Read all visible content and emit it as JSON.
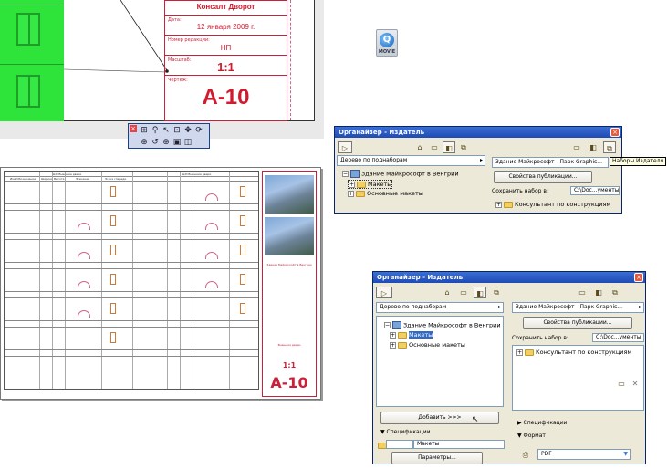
{
  "drawing_top": {
    "title_block": {
      "author_value": "Консалт Дворот",
      "date_label": "Дата:",
      "date_value": "12 января 2009 г.",
      "revision_label": "Номер редакции:",
      "revision_value": "НП",
      "scale_label": "Масштаб:",
      "scale_value": "1:1",
      "sheet_label": "Чертеж:",
      "sheet_value": "A-10"
    }
  },
  "drawing_bottom": {
    "header_left": "Ш/И Внешние двери",
    "header_right": "Ш/И Внешние двери",
    "col_headers": [
      "Имя/Обозначение",
      "Ширина",
      "Высота",
      "Эскизная",
      "Эскиз спереди"
    ],
    "title_project": "Здание Майкрософт в Венгрии",
    "title_sheet_name": "Внешние двери",
    "title_scale": "1:1",
    "title_sheet": "A-10"
  },
  "movie_icon": {
    "label": "MOVIE"
  },
  "organizer_small": {
    "title": "Органайзер - Издатель",
    "left_dropdown": "Дерево по поднаборам",
    "right_dropdown": "Здание Майкрософт - Парк Graphis...",
    "tooltip": "Наборы Издателя",
    "tree": [
      "Здание Майкрософт в Венгрии",
      "Макеты",
      "Основные макеты"
    ],
    "publish_props_button": "Свойства публикации...",
    "save_set_label": "Сохранить набор в:",
    "save_set_path": "C:\\Doc...ументы",
    "right_tree_item": "Консультант по конструкциям"
  },
  "organizer_large": {
    "title": "Органайзер - Издатель",
    "left_dropdown": "Дерево по поднаборам",
    "right_dropdown": "Здание Майкрософт - Парк Graphis...",
    "tree": [
      "Здание Майкрософт в Венгрии",
      "Макеты",
      "Основные макеты"
    ],
    "publish_props_button": "Свойства публикации...",
    "save_set_label": "Сохранить набор в:",
    "save_set_path": "C:\\Doc...ументы",
    "right_tree_item": "Консультант по конструкциям",
    "add_button": "Добавить >>>",
    "specs_left": "Спецификации",
    "layouts_field": "Макеты",
    "params_button": "Параметры...",
    "specs_right": "Спецификации",
    "format_label": "Формат",
    "format_value": "PDF"
  }
}
